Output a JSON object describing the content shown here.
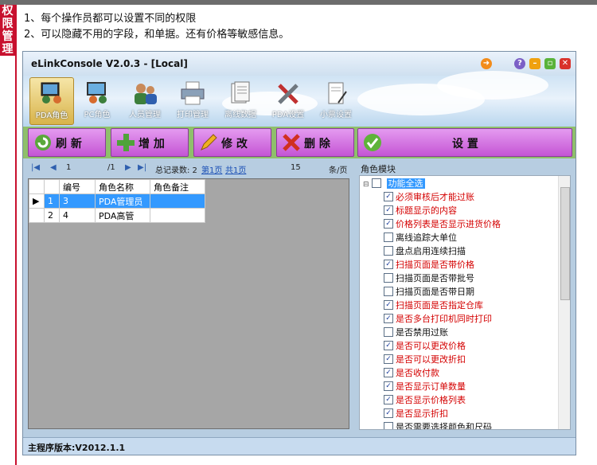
{
  "side_tag": "权限管理",
  "intro": {
    "line1": "1、每个操作员都可以设置不同的权限",
    "line2": "2、可以隐藏不用的字段，和单据。还有价格等敏感信息。"
  },
  "window": {
    "title": "eLinkConsole V2.0.3 - [Local]",
    "status": "主程序版本:V2012.1.1"
  },
  "nav": [
    {
      "label": "PDA角色",
      "icon": "pda-role-icon",
      "active": true
    },
    {
      "label": "PC角色",
      "icon": "pc-role-icon"
    },
    {
      "label": "人员管理",
      "icon": "user-management-icon"
    },
    {
      "label": "打印管理",
      "icon": "printer-icon"
    },
    {
      "label": "离线数据",
      "icon": "offline-data-icon"
    },
    {
      "label": "PDA设置",
      "icon": "pda-settings-icon"
    },
    {
      "label": "小票设置",
      "icon": "receipt-settings-icon"
    }
  ],
  "toolbar": {
    "refresh": "刷 新",
    "add": "增 加",
    "edit": "修 改",
    "delete": "删 除",
    "settings": "设 置"
  },
  "pager": {
    "page": "1",
    "of": "/1",
    "records": "总记录数: 2",
    "first": "第1页",
    "total": "共1页",
    "page_size": "15",
    "per_page": "条/页"
  },
  "table": {
    "headers": [
      "编号",
      "角色名称",
      "角色备注"
    ],
    "rows": [
      {
        "idx": "1",
        "id": "3",
        "name": "PDA管理员",
        "note": ""
      },
      {
        "idx": "2",
        "id": "4",
        "name": "PDA高管",
        "note": ""
      }
    ]
  },
  "role_module": {
    "title": "角色模块",
    "root": "功能全选",
    "items": [
      {
        "label": "必须审核后才能过账",
        "checked": true
      },
      {
        "label": "标题显示的内容",
        "checked": true
      },
      {
        "label": "价格列表是否显示进货价格",
        "checked": true
      },
      {
        "label": "离线追踪大单位",
        "checked": false
      },
      {
        "label": "盘点启用连续扫描",
        "checked": false
      },
      {
        "label": "扫描页面是否带价格",
        "checked": true
      },
      {
        "label": "扫描页面是否带批号",
        "checked": false
      },
      {
        "label": "扫描页面是否带日期",
        "checked": false
      },
      {
        "label": "扫描页面是否指定仓库",
        "checked": true
      },
      {
        "label": "是否多台打印机同时打印",
        "checked": true
      },
      {
        "label": "是否禁用过账",
        "checked": false
      },
      {
        "label": "是否可以更改价格",
        "checked": true
      },
      {
        "label": "是否可以更改折扣",
        "checked": true
      },
      {
        "label": "是否收付款",
        "checked": true
      },
      {
        "label": "是否显示订单数量",
        "checked": true
      },
      {
        "label": "是否显示价格列表",
        "checked": true
      },
      {
        "label": "是否显示折扣",
        "checked": true
      },
      {
        "label": "是否需要选择颜色和尺码",
        "checked": false
      }
    ]
  },
  "colors": {
    "checked_text": "#d40000",
    "unchecked_text": "#111111",
    "accent": "#c8102e"
  }
}
